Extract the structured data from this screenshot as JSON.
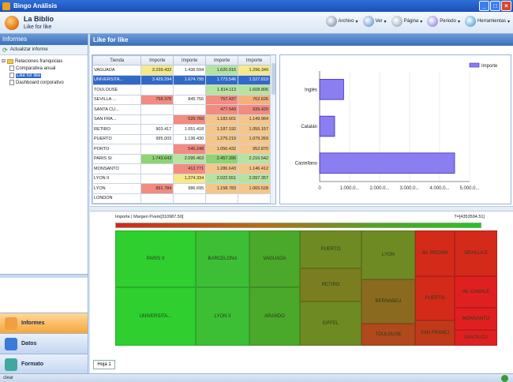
{
  "window": {
    "title": "Bingo Análisis"
  },
  "header": {
    "title": "La Biblio",
    "subtitle": "Like for like"
  },
  "toolbar": [
    {
      "label": "Archivo",
      "icon": "archive-icon"
    },
    {
      "label": "Ver",
      "icon": "view-icon"
    },
    {
      "label": "Página",
      "icon": "page-icon"
    },
    {
      "label": "Periodo",
      "icon": "period-icon"
    },
    {
      "label": "Herramientas",
      "icon": "tools-icon"
    }
  ],
  "sidebar": {
    "title": "Informes",
    "refresh_label": "Actualizar informe",
    "tree": [
      {
        "label": "Relaciones franquicias",
        "type": "folder",
        "level": 0
      },
      {
        "label": "Comparativa anual",
        "type": "doc",
        "level": 1
      },
      {
        "label": "Like for like",
        "type": "doc",
        "level": 1,
        "selected": true
      },
      {
        "label": "Dashboard corporativo",
        "type": "doc",
        "level": 1
      }
    ],
    "nav": [
      {
        "label": "Informes",
        "active": true,
        "icon": "reports-icon",
        "color": "#f0a040"
      },
      {
        "label": "Datos",
        "active": false,
        "icon": "data-icon",
        "color": "#3a7ad8"
      },
      {
        "label": "Formato",
        "active": false,
        "icon": "format-icon",
        "color": "#40a8a0"
      }
    ]
  },
  "main": {
    "title": "Like for like",
    "sheet_tab": "Hoja 1"
  },
  "table": {
    "columns": [
      "Tienda",
      "Importe",
      "Importe",
      "Importe",
      "Importe"
    ],
    "rows": [
      {
        "name": "VAGUADA",
        "cells": [
          "3.239.432",
          "1.436.594",
          "1.620.916",
          "1.296.349"
        ],
        "colors": [
          "#f6e98a",
          "#ffffff",
          "#b7e3a0",
          "#f6e98a"
        ]
      },
      {
        "name": "UNIVERSITA...",
        "cells": [
          "3.429.294",
          "1.674.795",
          "1.773.546",
          "1.527.819"
        ],
        "colors": [
          "#3169c6",
          "#3169c6",
          "#3169c6",
          "#3169c6"
        ],
        "selected": true
      },
      {
        "name": "TOULOUSE",
        "cells": [
          "",
          "",
          "1.814.113",
          "1.608.806"
        ],
        "colors": [
          "#ffffff",
          "#ffffff",
          "#b7e3a0",
          "#b7e3a0"
        ]
      },
      {
        "name": "SEVILLA ...",
        "cells": [
          "758.378",
          "845.756",
          "757.437",
          "762.626"
        ],
        "colors": [
          "#f28b80",
          "#ffffff",
          "#f28b80",
          "#f5b07a"
        ]
      },
      {
        "name": "SANTA CU...",
        "cells": [
          "",
          "",
          "477.549",
          "939.429"
        ],
        "colors": [
          "#ffffff",
          "#ffffff",
          "#f28b80",
          "#f28b80"
        ]
      },
      {
        "name": "SAN FRA...",
        "cells": [
          "",
          "529.760",
          "1.183.601",
          "1.149.964"
        ],
        "colors": [
          "#ffffff",
          "#f28b80",
          "#f5c68a",
          "#f5c68a"
        ]
      },
      {
        "name": "RETIRO",
        "cells": [
          "903.417",
          "1.051.418",
          "1.187.192",
          "1.055.157"
        ],
        "colors": [
          "#ffffff",
          "#ffffff",
          "#f5c68a",
          "#f5c68a"
        ]
      },
      {
        "name": "PUERTO",
        "cells": [
          "995.003",
          "1.136.430",
          "1.279.219",
          "1.079.269"
        ],
        "colors": [
          "#ffffff",
          "#ffffff",
          "#f5c68a",
          "#f5c68a"
        ]
      },
      {
        "name": "PORTO",
        "cells": [
          "",
          "545.248",
          "1.050.432",
          "952.870"
        ],
        "colors": [
          "#ffffff",
          "#f28b80",
          "#f5c68a",
          "#f5c68a"
        ]
      },
      {
        "name": "PARIS SI",
        "cells": [
          "1.743.643",
          "2.095.463",
          "2.457.396",
          "2.216.542"
        ],
        "colors": [
          "#8fd470",
          "#b7e3a0",
          "#8fd470",
          "#b7e3a0"
        ]
      },
      {
        "name": "MONSANTO",
        "cells": [
          "",
          "412.771",
          "1.286.643",
          "1.146.412"
        ],
        "colors": [
          "#ffffff",
          "#f28b80",
          "#f5c68a",
          "#f5c68a"
        ]
      },
      {
        "name": "LYON II",
        "cells": [
          "",
          "1.274.334",
          "2.022.551",
          "2.097.357"
        ],
        "colors": [
          "#ffffff",
          "#f6e98a",
          "#b7e3a0",
          "#b7e3a0"
        ]
      },
      {
        "name": "LYON",
        "cells": [
          "891.784",
          "986.695",
          "1.158.783",
          "1.065.528"
        ],
        "colors": [
          "#f28b80",
          "#ffffff",
          "#f5c68a",
          "#f5c68a"
        ]
      },
      {
        "name": "LONDON",
        "cells": [
          "",
          "",
          "",
          ""
        ],
        "colors": [
          "#ffffff",
          "#ffffff",
          "#ffffff",
          "#ffffff"
        ]
      }
    ]
  },
  "chart_data": {
    "type": "bar",
    "orientation": "horizontal",
    "categories": [
      "Inglés",
      "Catalán",
      "Castellano"
    ],
    "series": [
      {
        "name": "Importe",
        "values": [
          800,
          500,
          4500
        ]
      }
    ],
    "xlim": [
      0,
      5000
    ],
    "xticks": [
      "0",
      "1.000.0...",
      "2.000.0...",
      "3.000.0...",
      "4.000.0...",
      "5.000.0..."
    ],
    "legend": "top-right",
    "bar_color": "#8a7ef0"
  },
  "heatmap": {
    "legend_left": "Importe | Margen Pvem[310987.50]",
    "legend_right": "T=[4353594.51]",
    "tiles": [
      {
        "label": "PARIS II",
        "color": "#2ecf2e"
      },
      {
        "label": "UNIVERSITA...",
        "color": "#2ecf2e"
      },
      {
        "label": "BARCELONA",
        "color": "#3cbf35"
      },
      {
        "label": "LYON II",
        "color": "#3cbf35"
      },
      {
        "label": "VAGUADA",
        "color": "#4aa82a"
      },
      {
        "label": "ARANDO",
        "color": "#4aa82a"
      },
      {
        "label": "PUERTO",
        "color": "#6e8a22"
      },
      {
        "label": "RETIRO",
        "color": "#7a7e20"
      },
      {
        "label": "EIFFEL",
        "color": "#6e8a22"
      },
      {
        "label": "LYON",
        "color": "#6e8a22"
      },
      {
        "label": "BERNABEU",
        "color": "#8a6a1e"
      },
      {
        "label": "TOULOUSE",
        "color": "#b04a1c"
      },
      {
        "label": "AV. PECHIN",
        "color": "#d42a1a"
      },
      {
        "label": "SEVILLA E",
        "color": "#d42a1a"
      },
      {
        "label": "PUERTO",
        "color": "#d42a1a"
      },
      {
        "label": "AV. CANALE",
        "color": "#e02020"
      },
      {
        "label": "SAN FRANCI",
        "color": "#c03a1a"
      },
      {
        "label": "MONSANTO",
        "color": "#e02020"
      },
      {
        "label": "SANTA CU",
        "color": "#e02020"
      }
    ]
  },
  "status": {
    "text": "clear"
  }
}
